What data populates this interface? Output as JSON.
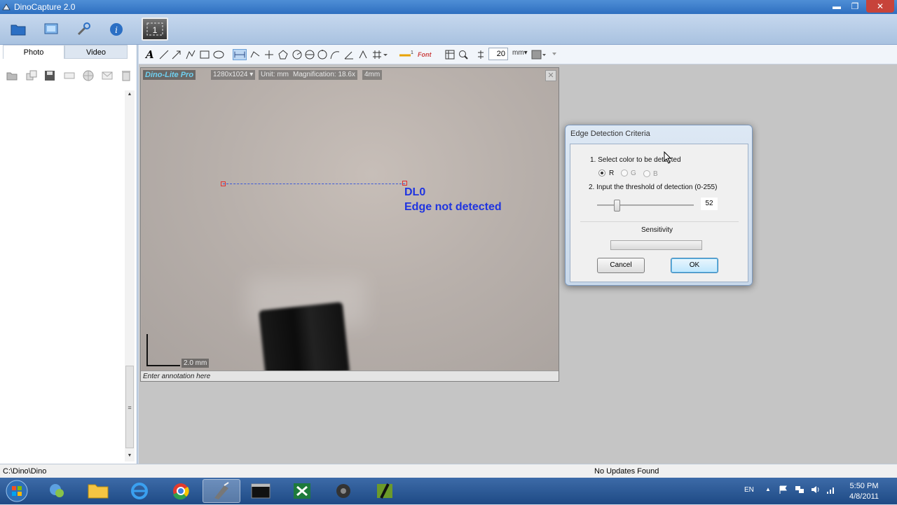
{
  "window": {
    "title": "DinoCapture 2.0",
    "controls": {
      "minimize": "▬",
      "maximize": "❐",
      "close": "✕"
    }
  },
  "ribbon": {
    "buttons": [
      "folder-icon",
      "monitor-icon",
      "tools-icon",
      "info-icon",
      "camera-capture-icon"
    ]
  },
  "left_panel": {
    "tabs": [
      {
        "label": "Photo"
      },
      {
        "label": "Video"
      }
    ],
    "icons": [
      "open-icon",
      "copy-icon",
      "save-icon",
      "rename-icon",
      "globe-icon",
      "email-icon",
      "delete-icon"
    ],
    "scroll_up": "▲",
    "scroll_grip": "≡",
    "scroll_down": "▼"
  },
  "toolbar": {
    "text_tool": "A",
    "zoom_value": "20",
    "unit": "mm▾",
    "font_tool": "Font"
  },
  "preview": {
    "brand": "Dino-Lite Pro",
    "resolution": "1280x1024 ▾",
    "unit": "Unit: mm",
    "magnification": "Magnification: 18.6x",
    "fov": "4mm",
    "measurement_label": "DL0",
    "measurement_status": "Edge not detected",
    "scale_label": "2.0 mm",
    "annotation_placeholder": "Enter annotation here",
    "close_symbol": "✕"
  },
  "dialog": {
    "title": "Edge Detection Criteria",
    "step1": "1. Select color to be detected",
    "radio_r": "R",
    "radio_g": "G",
    "radio_b": "B",
    "selected_color": "R",
    "step2": "2. Input the threshold of detection (0-255)",
    "threshold": "52",
    "threshold_max": 255,
    "sensitivity_label": "Sensitivity",
    "cancel": "Cancel",
    "ok": "OK"
  },
  "status_bar": {
    "path": "C:\\Dino\\Dino",
    "update": "No Updates Found"
  },
  "taskbar": {
    "lang": "EN",
    "time": "5:50 PM",
    "date": "4/8/2011",
    "apps": [
      "windows-start-icon",
      "messenger-icon",
      "explorer-folder-icon",
      "internet-explorer-icon",
      "chrome-icon",
      "dinocapture-icon",
      "cmd-icon",
      "excel-icon",
      "camera-icon",
      "capture-app-icon"
    ]
  },
  "colors": {
    "measure_text": "#1f34e0",
    "brand_text": "#6fd0f0"
  }
}
